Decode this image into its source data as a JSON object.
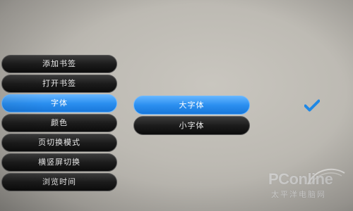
{
  "menu": {
    "items": [
      {
        "label": "添加书签",
        "selected": false
      },
      {
        "label": "打开书签",
        "selected": false
      },
      {
        "label": "字体",
        "selected": true
      },
      {
        "label": "颜色",
        "selected": false
      },
      {
        "label": "页切换模式",
        "selected": false
      },
      {
        "label": "横竖屏切换",
        "selected": false
      },
      {
        "label": "浏览时间",
        "selected": false
      }
    ]
  },
  "submenu": {
    "items": [
      {
        "label": "大字体",
        "selected": true
      },
      {
        "label": "小字体",
        "selected": false
      }
    ]
  },
  "check": {
    "icon": "checkmark-icon",
    "color": "#1f88e5"
  },
  "watermark": {
    "brand": "PConline",
    "subtitle": "太平洋电脑网"
  },
  "colors": {
    "accent": "#2b8ff0",
    "button_dark": "#1c1c1c",
    "background": "#bdbab3"
  }
}
